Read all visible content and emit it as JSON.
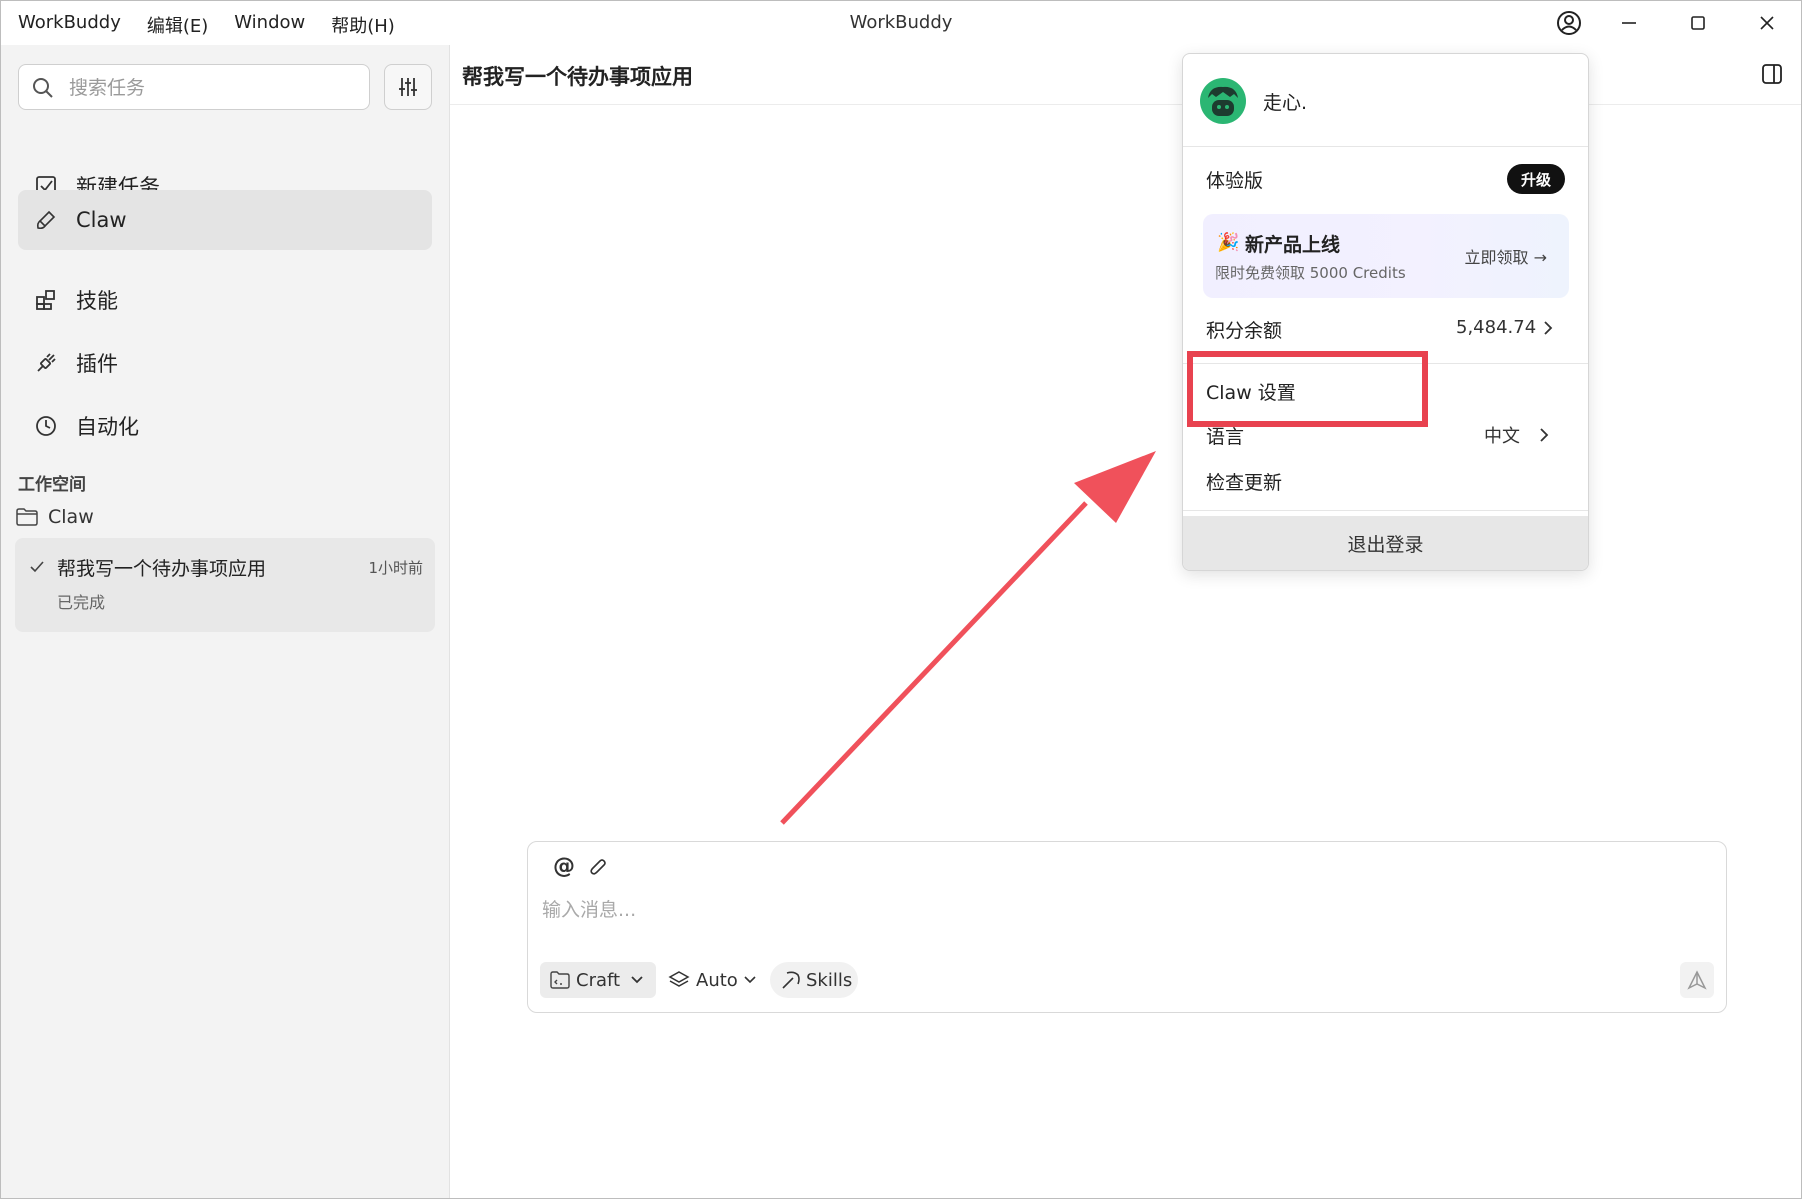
{
  "titlebar": {
    "app_title": "WorkBuddy",
    "menus": [
      "WorkBuddy",
      "编辑(E)",
      "Window",
      "帮助(H)"
    ]
  },
  "sidebar": {
    "search_placeholder": "搜索任务",
    "nav": [
      {
        "label": "新建任务",
        "icon": "new-task-icon"
      },
      {
        "label": "Claw",
        "icon": "claw-brush-icon",
        "active": true
      },
      {
        "label": "技能",
        "icon": "skills-grid-icon"
      },
      {
        "label": "插件",
        "icon": "plugin-icon"
      },
      {
        "label": "自动化",
        "icon": "clock-icon"
      }
    ],
    "workspace_label": "工作空间",
    "folder": "Claw",
    "task": {
      "title": "帮我写一个待办事项应用",
      "time": "1小时前",
      "status": "已完成"
    }
  },
  "main": {
    "title": "帮我写一个待办事项应用"
  },
  "composer": {
    "placeholder": "输入消息...",
    "mode": "Craft",
    "model": "Auto",
    "skills": "Skills"
  },
  "account_menu": {
    "username": "走心.",
    "plan": "体验版",
    "upgrade": "升级",
    "promo": {
      "title": "新产品上线",
      "subtitle": "限时免费领取 5000 Credits",
      "action": "立即领取 →"
    },
    "credits_label": "积分余额",
    "credits_value": "5,484.74",
    "claw_settings": "Claw 设置",
    "language_label": "语言",
    "language_value": "中文",
    "check_update": "检查更新",
    "logout": "退出登录"
  },
  "colors": {
    "annotation": "#e8424f",
    "sidebar_bg": "#f3f3f3",
    "avatar": "#2bb673"
  }
}
